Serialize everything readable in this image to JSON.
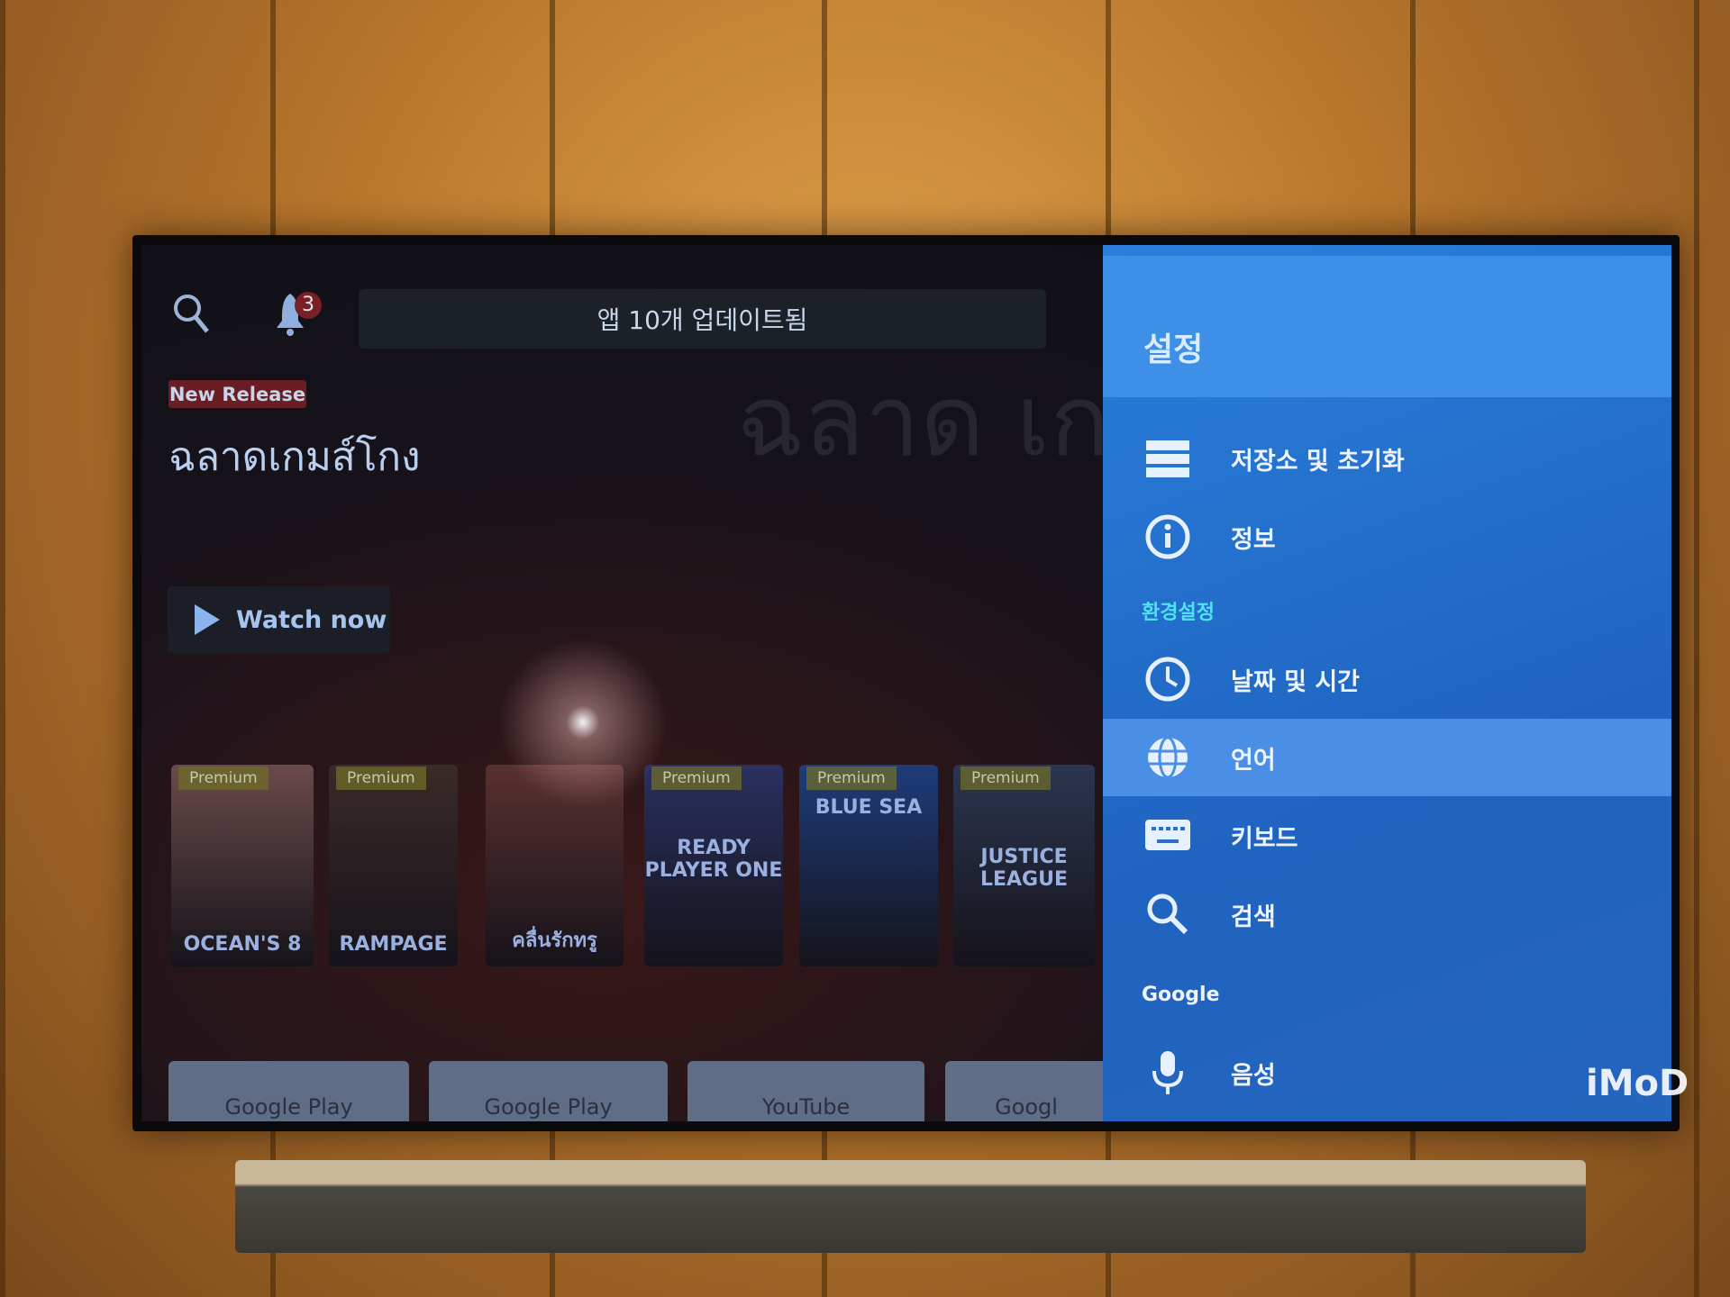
{
  "topbar": {
    "notification_count": "3",
    "update_message": "앱 10개 업데이트됨"
  },
  "hero": {
    "badge": "New Release",
    "title": "ฉลาดเกมส์โกง",
    "watermark_title": "ฉลาด เกมส์โกง",
    "watch_label": "Watch now"
  },
  "posters": [
    {
      "premium": "Premium",
      "title": "OCEAN'S 8",
      "color": "#6a4a4a"
    },
    {
      "premium": "Premium",
      "title": "RAMPAGE",
      "color": "#3a2a28"
    },
    {
      "premium": "",
      "title": "คลื่นรักทรู",
      "color": "#5a3030"
    },
    {
      "premium": "Premium",
      "title": "READY PLAYER ONE",
      "color": "#2a3060"
    },
    {
      "premium": "Premium",
      "title": "BLUE SEA",
      "color": "#1e3c7a"
    },
    {
      "premium": "Premium",
      "title": "JUSTICE LEAGUE",
      "color": "#2c3550"
    }
  ],
  "apps": [
    "Google Play",
    "Google Play",
    "YouTube",
    "Googl"
  ],
  "settings": {
    "title": "설정",
    "items": [
      {
        "label": "저장소 및 초기화",
        "icon": "storage-icon"
      },
      {
        "label": "정보",
        "icon": "info-icon"
      }
    ],
    "section_preferences": "환경설정",
    "pref_items": [
      {
        "label": "날짜 및 시간",
        "icon": "clock-icon"
      },
      {
        "label": "언어",
        "icon": "globe-icon",
        "selected": true
      },
      {
        "label": "키보드",
        "icon": "keyboard-icon"
      },
      {
        "label": "검색",
        "icon": "search-icon"
      }
    ],
    "section_google": "Google",
    "google_items": [
      {
        "label": "음성",
        "icon": "microphone-icon"
      }
    ]
  },
  "colors": {
    "panel": "#2a7fdc",
    "header": "#3d8fe8",
    "selected": "#4a8fe6",
    "section_accent": "#4fe3f0"
  },
  "watermark_logo": "iMoD"
}
